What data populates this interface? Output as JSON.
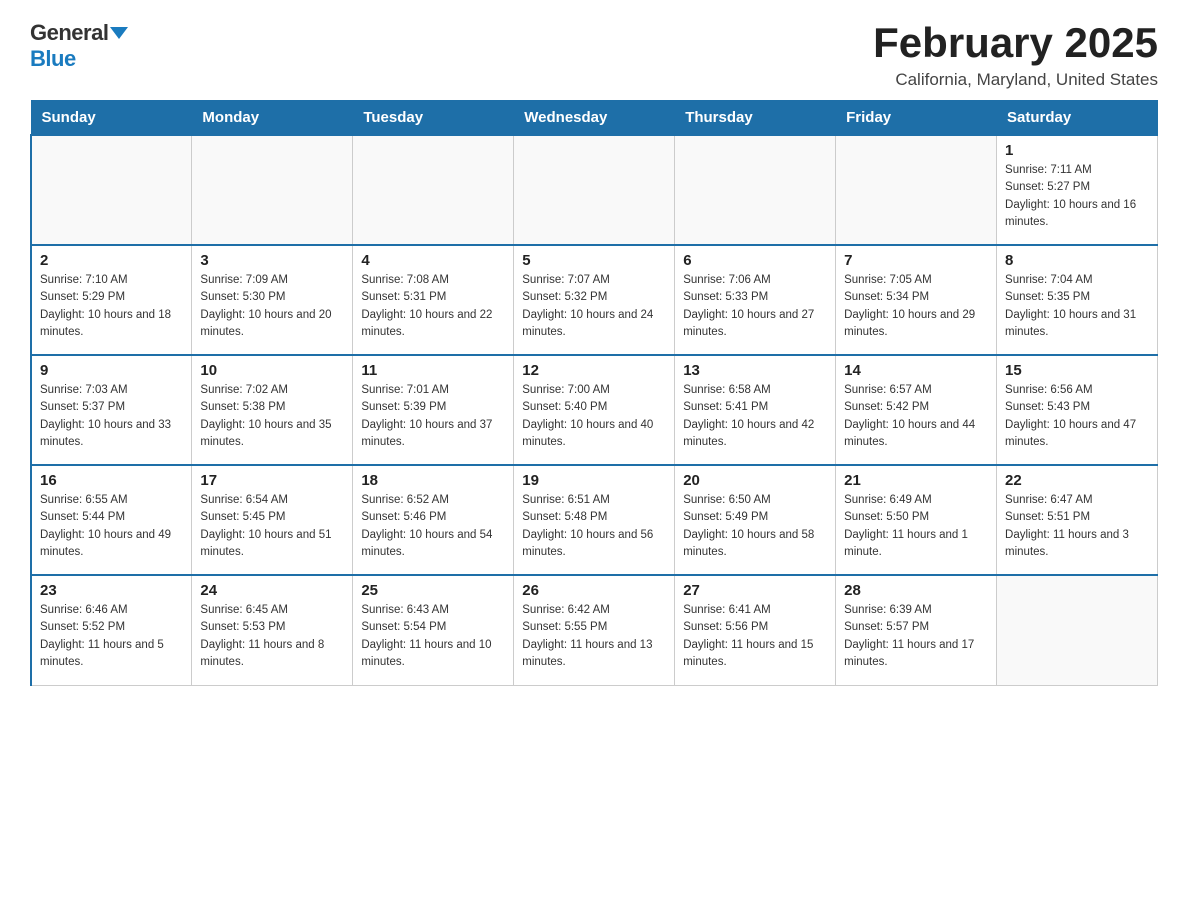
{
  "logo": {
    "general": "General",
    "blue": "Blue"
  },
  "header": {
    "title": "February 2025",
    "subtitle": "California, Maryland, United States"
  },
  "days_of_week": [
    "Sunday",
    "Monday",
    "Tuesday",
    "Wednesday",
    "Thursday",
    "Friday",
    "Saturday"
  ],
  "weeks": [
    [
      {
        "day": "",
        "info": ""
      },
      {
        "day": "",
        "info": ""
      },
      {
        "day": "",
        "info": ""
      },
      {
        "day": "",
        "info": ""
      },
      {
        "day": "",
        "info": ""
      },
      {
        "day": "",
        "info": ""
      },
      {
        "day": "1",
        "info": "Sunrise: 7:11 AM\nSunset: 5:27 PM\nDaylight: 10 hours and 16 minutes."
      }
    ],
    [
      {
        "day": "2",
        "info": "Sunrise: 7:10 AM\nSunset: 5:29 PM\nDaylight: 10 hours and 18 minutes."
      },
      {
        "day": "3",
        "info": "Sunrise: 7:09 AM\nSunset: 5:30 PM\nDaylight: 10 hours and 20 minutes."
      },
      {
        "day": "4",
        "info": "Sunrise: 7:08 AM\nSunset: 5:31 PM\nDaylight: 10 hours and 22 minutes."
      },
      {
        "day": "5",
        "info": "Sunrise: 7:07 AM\nSunset: 5:32 PM\nDaylight: 10 hours and 24 minutes."
      },
      {
        "day": "6",
        "info": "Sunrise: 7:06 AM\nSunset: 5:33 PM\nDaylight: 10 hours and 27 minutes."
      },
      {
        "day": "7",
        "info": "Sunrise: 7:05 AM\nSunset: 5:34 PM\nDaylight: 10 hours and 29 minutes."
      },
      {
        "day": "8",
        "info": "Sunrise: 7:04 AM\nSunset: 5:35 PM\nDaylight: 10 hours and 31 minutes."
      }
    ],
    [
      {
        "day": "9",
        "info": "Sunrise: 7:03 AM\nSunset: 5:37 PM\nDaylight: 10 hours and 33 minutes."
      },
      {
        "day": "10",
        "info": "Sunrise: 7:02 AM\nSunset: 5:38 PM\nDaylight: 10 hours and 35 minutes."
      },
      {
        "day": "11",
        "info": "Sunrise: 7:01 AM\nSunset: 5:39 PM\nDaylight: 10 hours and 37 minutes."
      },
      {
        "day": "12",
        "info": "Sunrise: 7:00 AM\nSunset: 5:40 PM\nDaylight: 10 hours and 40 minutes."
      },
      {
        "day": "13",
        "info": "Sunrise: 6:58 AM\nSunset: 5:41 PM\nDaylight: 10 hours and 42 minutes."
      },
      {
        "day": "14",
        "info": "Sunrise: 6:57 AM\nSunset: 5:42 PM\nDaylight: 10 hours and 44 minutes."
      },
      {
        "day": "15",
        "info": "Sunrise: 6:56 AM\nSunset: 5:43 PM\nDaylight: 10 hours and 47 minutes."
      }
    ],
    [
      {
        "day": "16",
        "info": "Sunrise: 6:55 AM\nSunset: 5:44 PM\nDaylight: 10 hours and 49 minutes."
      },
      {
        "day": "17",
        "info": "Sunrise: 6:54 AM\nSunset: 5:45 PM\nDaylight: 10 hours and 51 minutes."
      },
      {
        "day": "18",
        "info": "Sunrise: 6:52 AM\nSunset: 5:46 PM\nDaylight: 10 hours and 54 minutes."
      },
      {
        "day": "19",
        "info": "Sunrise: 6:51 AM\nSunset: 5:48 PM\nDaylight: 10 hours and 56 minutes."
      },
      {
        "day": "20",
        "info": "Sunrise: 6:50 AM\nSunset: 5:49 PM\nDaylight: 10 hours and 58 minutes."
      },
      {
        "day": "21",
        "info": "Sunrise: 6:49 AM\nSunset: 5:50 PM\nDaylight: 11 hours and 1 minute."
      },
      {
        "day": "22",
        "info": "Sunrise: 6:47 AM\nSunset: 5:51 PM\nDaylight: 11 hours and 3 minutes."
      }
    ],
    [
      {
        "day": "23",
        "info": "Sunrise: 6:46 AM\nSunset: 5:52 PM\nDaylight: 11 hours and 5 minutes."
      },
      {
        "day": "24",
        "info": "Sunrise: 6:45 AM\nSunset: 5:53 PM\nDaylight: 11 hours and 8 minutes."
      },
      {
        "day": "25",
        "info": "Sunrise: 6:43 AM\nSunset: 5:54 PM\nDaylight: 11 hours and 10 minutes."
      },
      {
        "day": "26",
        "info": "Sunrise: 6:42 AM\nSunset: 5:55 PM\nDaylight: 11 hours and 13 minutes."
      },
      {
        "day": "27",
        "info": "Sunrise: 6:41 AM\nSunset: 5:56 PM\nDaylight: 11 hours and 15 minutes."
      },
      {
        "day": "28",
        "info": "Sunrise: 6:39 AM\nSunset: 5:57 PM\nDaylight: 11 hours and 17 minutes."
      },
      {
        "day": "",
        "info": ""
      }
    ]
  ]
}
